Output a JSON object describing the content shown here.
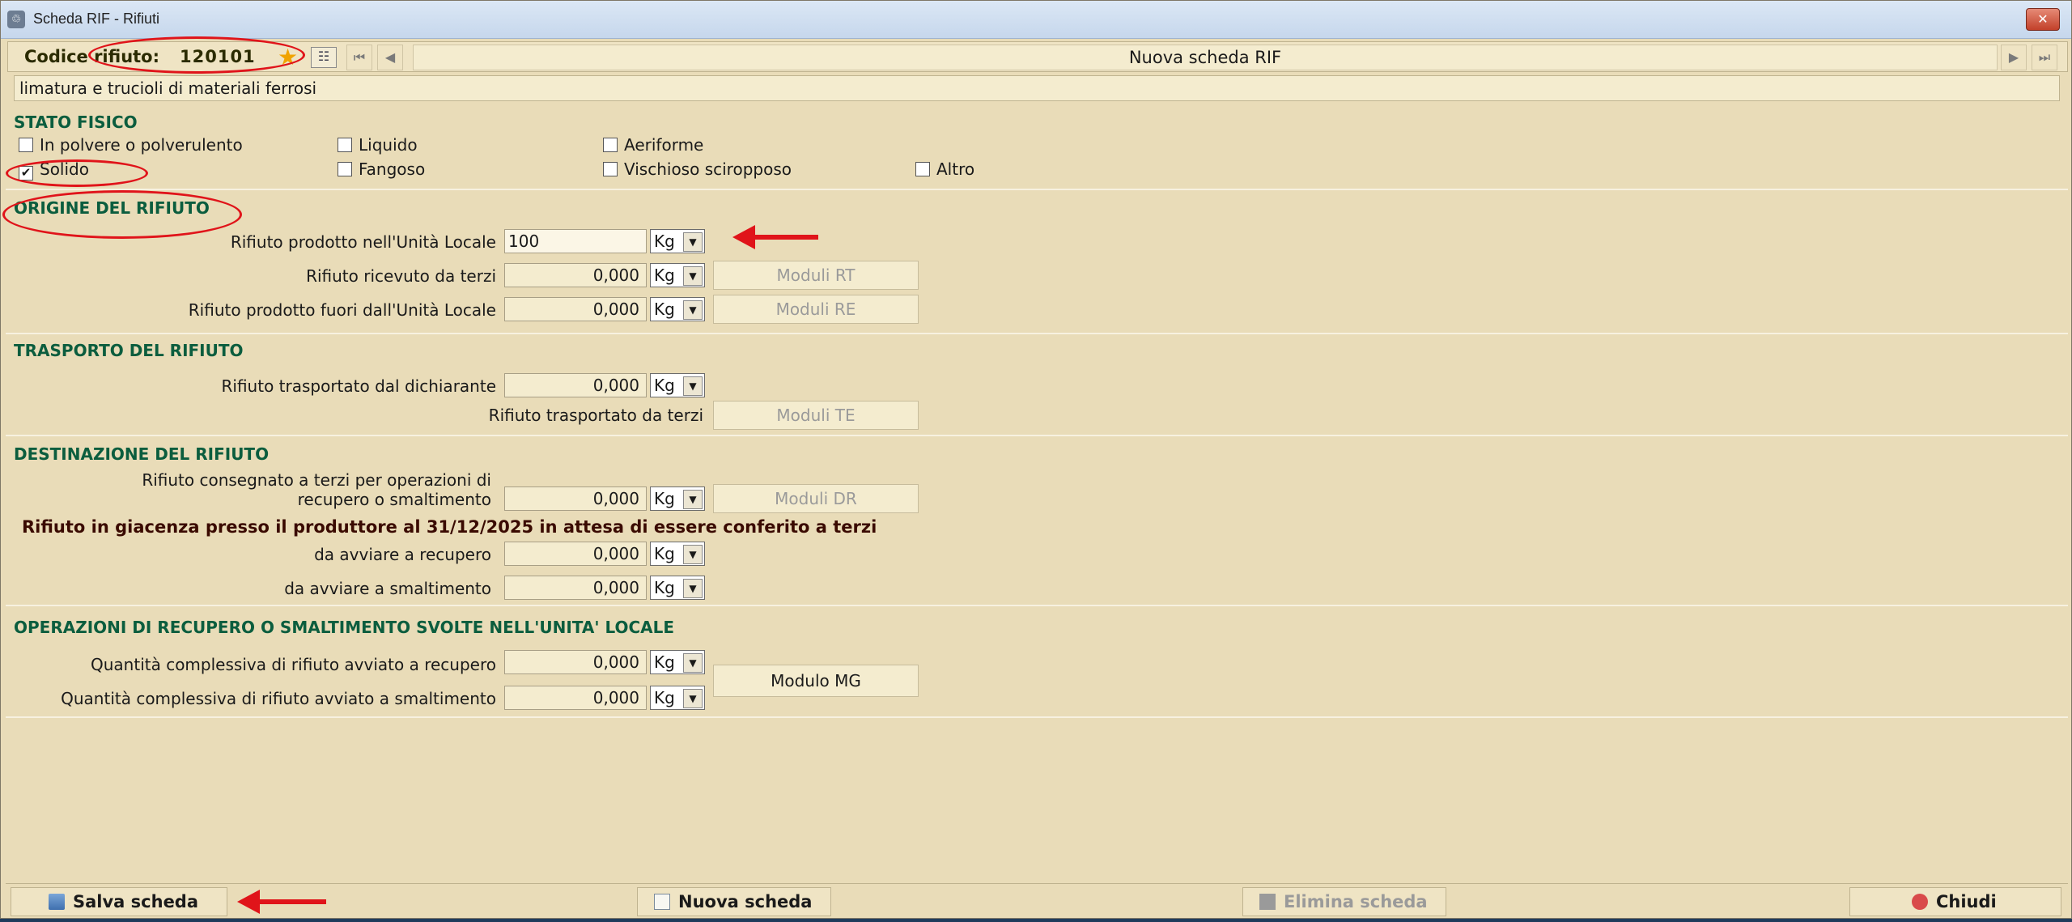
{
  "window": {
    "title": "Scheda RIF - Rifiuti",
    "close_glyph": "✕"
  },
  "toolbar": {
    "code_label": "Codice rifiuto:",
    "code_value": "120101",
    "record_title": "Nuova scheda RIF",
    "nav_first": "⏮",
    "nav_prev": "◀",
    "nav_next": "▶",
    "nav_last": "⏭"
  },
  "description": "limatura e trucioli di materiali ferrosi",
  "stato_fisico": {
    "title": "STATO FISICO",
    "options": [
      {
        "label": "In polvere o polverulento",
        "checked": false
      },
      {
        "label": "Liquido",
        "checked": false
      },
      {
        "label": "Aeriforme",
        "checked": false
      },
      {
        "label": "Solido",
        "checked": true
      },
      {
        "label": "Fangoso",
        "checked": false
      },
      {
        "label": "Vischioso sciropposo",
        "checked": false
      },
      {
        "label": "Altro",
        "checked": false
      }
    ]
  },
  "origine": {
    "title": "ORIGINE DEL RIFIUTO",
    "rows": [
      {
        "label": "Rifiuto prodotto nell'Unità Locale",
        "value": "100",
        "unit": "Kg"
      },
      {
        "label": "Rifiuto ricevuto da terzi",
        "value": "0,000",
        "unit": "Kg",
        "button": "Moduli RT"
      },
      {
        "label": "Rifiuto prodotto fuori dall'Unità Locale",
        "value": "0,000",
        "unit": "Kg",
        "button": "Moduli RE"
      }
    ]
  },
  "trasporto": {
    "title": "TRASPORTO DEL RIFIUTO",
    "row1": {
      "label": "Rifiuto trasportato dal dichiarante",
      "value": "0,000",
      "unit": "Kg"
    },
    "row2": {
      "label": "Rifiuto trasportato da terzi",
      "button": "Moduli TE"
    }
  },
  "destinazione": {
    "title": "DESTINAZIONE DEL RIFIUTO",
    "row1": {
      "label_line1": "Rifiuto consegnato a terzi per operazioni di",
      "label_line2": "recupero o smaltimento",
      "value": "0,000",
      "unit": "Kg",
      "button": "Moduli DR"
    },
    "giacenza": "Rifiuto in giacenza presso il produttore al 31/12/2025 in attesa di essere conferito a terzi",
    "row2": {
      "label": "da avviare a recupero",
      "value": "0,000",
      "unit": "Kg"
    },
    "row3": {
      "label": "da avviare a smaltimento",
      "value": "0,000",
      "unit": "Kg"
    }
  },
  "operazioni": {
    "title": "OPERAZIONI DI RECUPERO O SMALTIMENTO SVOLTE NELL'UNITA' LOCALE",
    "row1": {
      "label": "Quantità complessiva di rifiuto avviato a recupero",
      "value": "0,000",
      "unit": "Kg"
    },
    "row2": {
      "label": "Quantità complessiva di rifiuto avviato a smaltimento",
      "value": "0,000",
      "unit": "Kg"
    },
    "button": "Modulo MG"
  },
  "footer": {
    "save": "Salva scheda",
    "new": "Nuova scheda",
    "delete": "Elimina scheda",
    "close": "Chiudi"
  },
  "colors": {
    "background": "#e9dcb8",
    "section_title": "#0b5d3e",
    "annotation": "#e0141a"
  }
}
